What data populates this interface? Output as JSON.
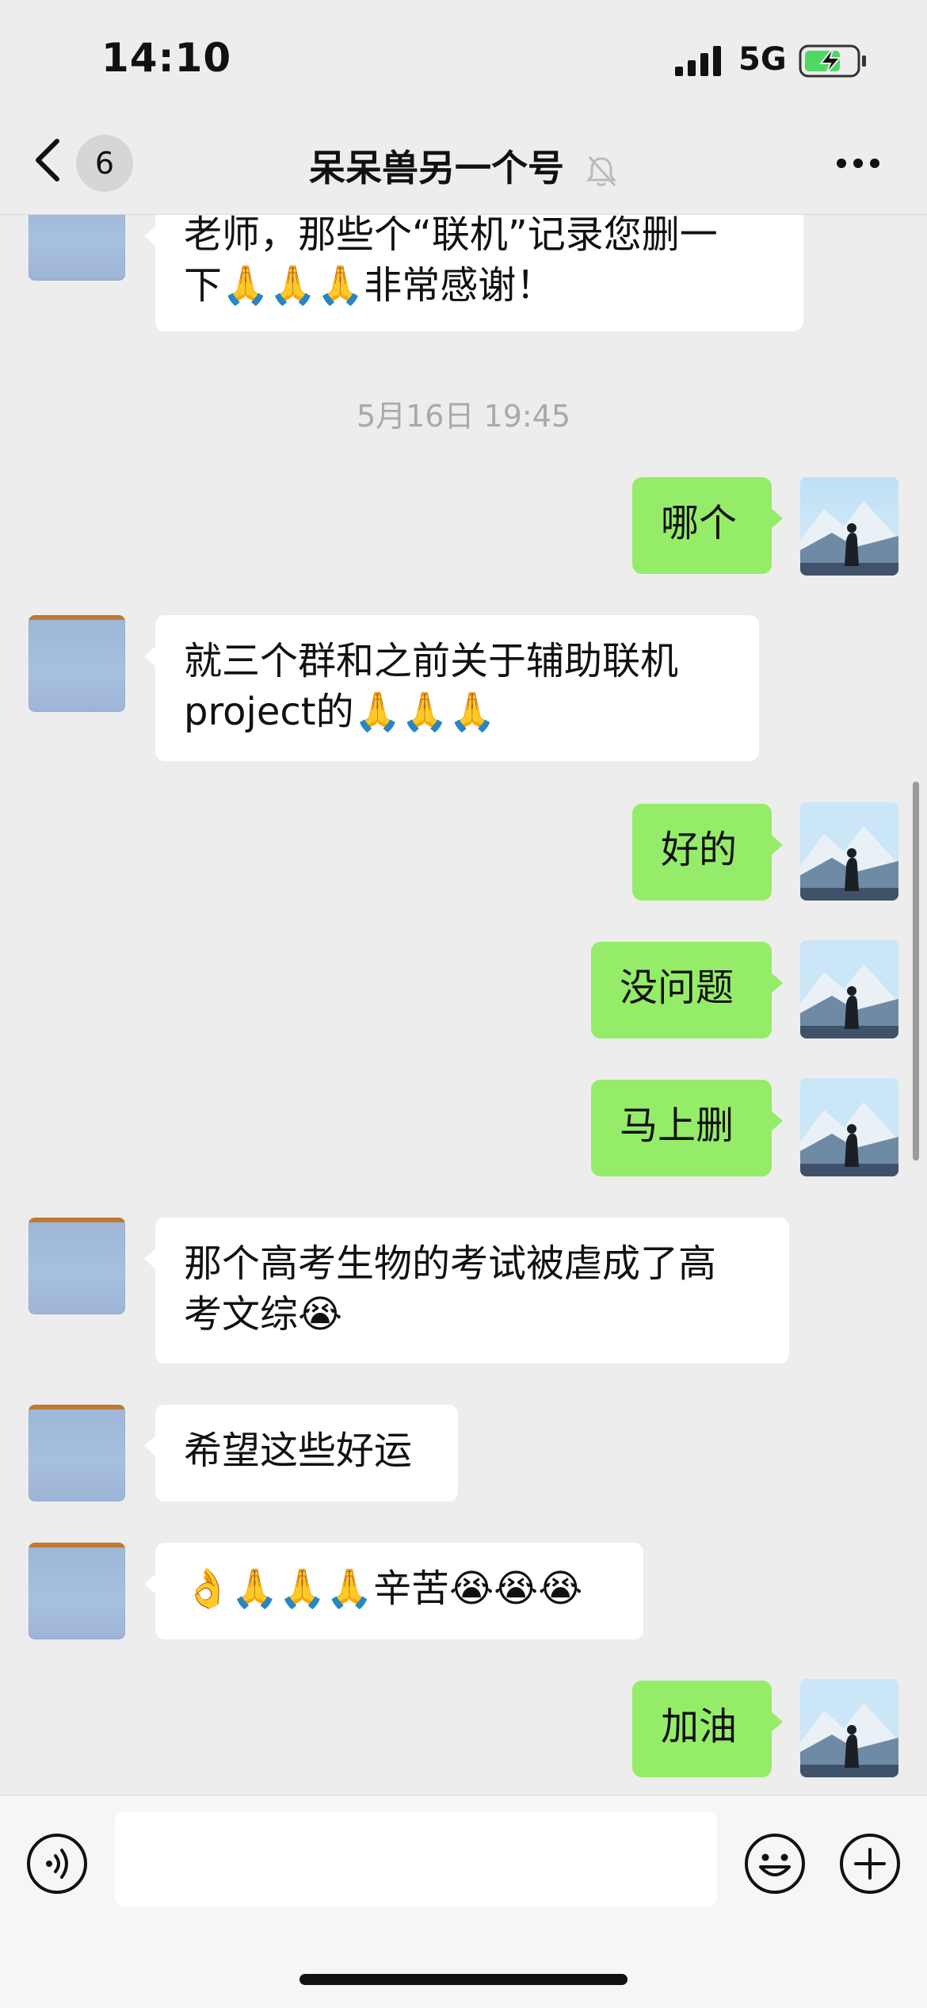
{
  "status_bar": {
    "time": "14:10",
    "network": "5G"
  },
  "nav": {
    "back_count": "6",
    "title": "呆呆兽另一个号"
  },
  "chat": {
    "timestamp": "5月16日 19:45",
    "messages": [
      {
        "side": "in",
        "text_lines": [
          "老师，那些个“联机”记录您删一",
          "下🙏🙏🙏非常感谢！"
        ]
      },
      {
        "side": "out",
        "text": "哪个"
      },
      {
        "side": "in",
        "text_lines": [
          "就三个群和之前关于辅助联机",
          "project的🙏🙏🙏"
        ]
      },
      {
        "side": "out",
        "text": "好的"
      },
      {
        "side": "out",
        "text": "没问题"
      },
      {
        "side": "out",
        "text": "马上删"
      },
      {
        "side": "in",
        "text_lines": [
          "那个高考生物的考试被虐成了高",
          "考文综😭"
        ]
      },
      {
        "side": "in",
        "text": "希望这些好运"
      },
      {
        "side": "in",
        "text": "👌🙏🙏🙏辛苦😭😭😭"
      },
      {
        "side": "out",
        "text": "加油"
      }
    ]
  },
  "input_bar": {
    "input_value": "",
    "icons": [
      "voice-icon",
      "emoji-icon",
      "plus-icon"
    ]
  }
}
